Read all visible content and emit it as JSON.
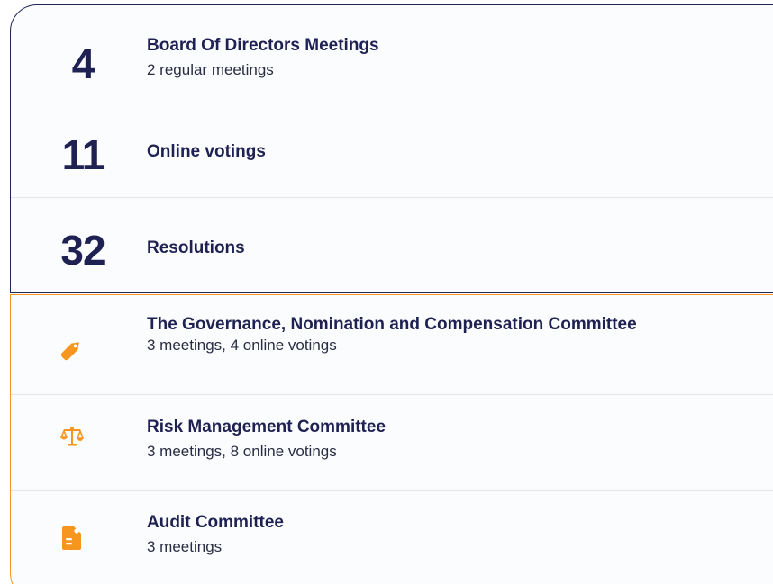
{
  "colors": {
    "navy": "#1e2152",
    "board_border": "#1e2556",
    "orange": "#f6961f",
    "divider": "#e3e5ea",
    "background": "#fbfcfd"
  },
  "board": {
    "items": [
      {
        "number": "4",
        "title": "Board Of Directors Meetings",
        "subtitle": "2 regular meetings"
      },
      {
        "number": "11",
        "title": "Online votings"
      },
      {
        "number": "32",
        "title": "Resolutions"
      }
    ]
  },
  "committees": {
    "items": [
      {
        "icon": "tag-icon",
        "title": "The Governance, Nomination and Compensation Committee",
        "subtitle": "3 meetings, 4 online votings"
      },
      {
        "icon": "scales-icon",
        "title": "Risk Management Committee",
        "subtitle": "3 meetings, 8 online votings"
      },
      {
        "icon": "document-icon",
        "title": "Audit Committee",
        "subtitle": "3 meetings"
      }
    ]
  }
}
